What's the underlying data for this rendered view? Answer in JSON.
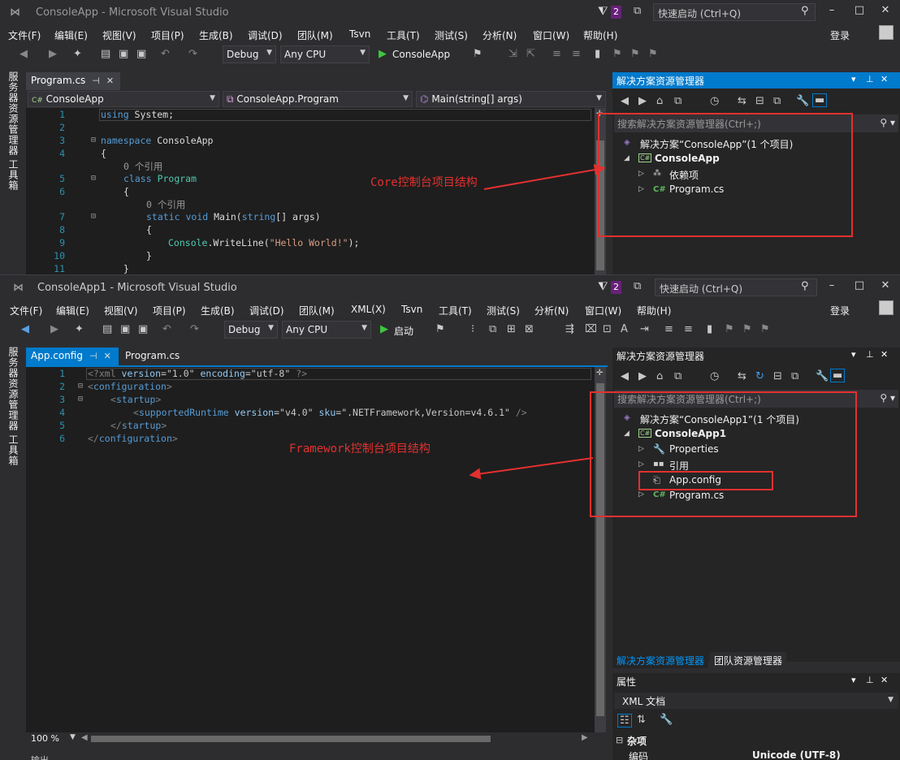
{
  "window1": {
    "title": "ConsoleApp - Microsoft Visual Studio",
    "notif_count": "2",
    "quick_launch_placeholder": "快速启动 (Ctrl+Q)",
    "login": "登录",
    "menu": [
      "文件(F)",
      "编辑(E)",
      "视图(V)",
      "项目(P)",
      "生成(B)",
      "调试(D)",
      "团队(M)",
      "Tsvn",
      "工具(T)",
      "测试(S)",
      "分析(N)",
      "窗口(W)",
      "帮助(H)"
    ],
    "toolbar": {
      "config": "Debug",
      "platform": "Any CPU",
      "run": "ConsoleApp"
    },
    "side_tabs": [
      "服务器资源管理器",
      "工具箱"
    ],
    "tab": "Program.cs",
    "nav": [
      "ConsoleApp",
      "ConsoleApp.Program",
      "Main(string[] args)"
    ],
    "lines": [
      "1",
      "2",
      "3",
      "4",
      "5",
      "6",
      "7",
      "8",
      "9",
      "10",
      "11"
    ],
    "code": {
      "l1_kw": "using",
      "l1_rest": " System;",
      "l3_kw": "namespace",
      "l3_rest": " ConsoleApp",
      "l4": "{",
      "ref1": "0 个引用",
      "l5_kw": "class",
      "l5_ty": "Program",
      "l6": "{",
      "ref2": "0 个引用",
      "l7_kw1": "static",
      "l7_kw2": "void",
      "l7_m": " Main(",
      "l7_kw3": "string",
      "l7_rest": "[] args)",
      "l8": "{",
      "l9_ty": "Console",
      "l9_m": ".WriteLine(",
      "l9_str": "\"Hello World!\"",
      "l9_end": ");",
      "l10": "}",
      "l11": "}"
    },
    "solution_explorer": {
      "title": "解决方案资源管理器",
      "search": "搜索解决方案资源管理器(Ctrl+;)",
      "solution": "解决方案“ConsoleApp”(1 个项目)",
      "project": "ConsoleApp",
      "items": [
        "依赖项",
        "Program.cs"
      ]
    },
    "annotation": "Core控制台项目结构"
  },
  "window2": {
    "title": "ConsoleApp1 - Microsoft Visual Studio",
    "notif_count": "2",
    "quick_launch_placeholder": "快速启动 (Ctrl+Q)",
    "login": "登录",
    "menu": [
      "文件(F)",
      "编辑(E)",
      "视图(V)",
      "项目(P)",
      "生成(B)",
      "调试(D)",
      "团队(M)",
      "XML(X)",
      "Tsvn",
      "工具(T)",
      "测试(S)",
      "分析(N)",
      "窗口(W)",
      "帮助(H)"
    ],
    "toolbar": {
      "config": "Debug",
      "platform": "Any CPU",
      "run": "启动"
    },
    "side_tabs": [
      "服务器资源管理器",
      "工具箱"
    ],
    "tabs": [
      "App.config",
      "Program.cs"
    ],
    "lines": [
      "1",
      "2",
      "3",
      "4",
      "5",
      "6"
    ],
    "xml": {
      "l1_d": "<?xml ",
      "l1_a1": "version",
      "l1_v1": "=\"1.0\" ",
      "l1_a2": "encoding",
      "l1_v2": "=\"utf-8\" ",
      "l1_e": "?>",
      "l2_b": "<",
      "l2_n": "configuration",
      "l2_e": ">",
      "l3_b": "<",
      "l3_n": "startup",
      "l3_e": ">",
      "l4_b": "<",
      "l4_n": "supportedRuntime",
      "l4_a1": " version",
      "l4_v1": "=\"v4.0\"",
      "l4_a2": " sku",
      "l4_v2": "=\".NETFramework,Version=v4.6.1\"",
      "l4_e": " />",
      "l5_b": "</",
      "l5_n": "startup",
      "l5_e": ">",
      "l6_b": "</",
      "l6_n": "configuration",
      "l6_e": ">"
    },
    "zoom": "100 %",
    "output_label": "输出",
    "solution_explorer": {
      "title": "解决方案资源管理器",
      "search": "搜索解决方案资源管理器(Ctrl+;)",
      "solution": "解决方案“ConsoleApp1”(1 个项目)",
      "project": "ConsoleApp1",
      "items": [
        "Properties",
        "引用",
        "App.config",
        "Program.cs"
      ]
    },
    "bottom_tabs": [
      "解决方案资源管理器",
      "团队资源管理器"
    ],
    "properties": {
      "title": "属性",
      "object": "XML 文档",
      "group": "杂项",
      "row_name": "编码",
      "row_value": "Unicode (UTF-8)"
    },
    "annotation": "Framework控制台项目结构"
  },
  "colors": {
    "accent": "#007acc",
    "annotation": "#e2312f",
    "editor_bg": "#1e1e1e",
    "chrome_bg": "#2d2d30"
  }
}
